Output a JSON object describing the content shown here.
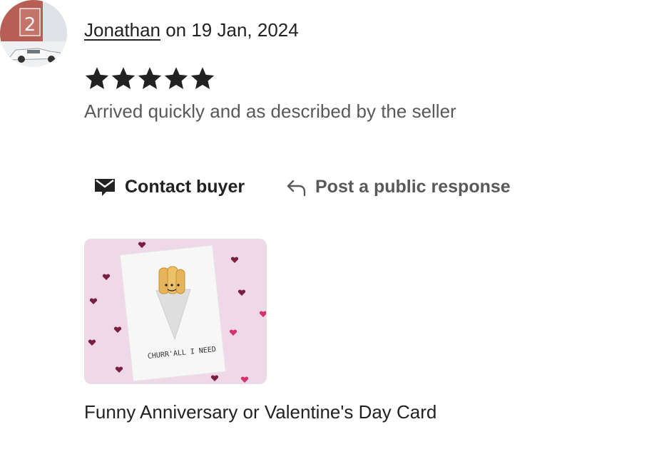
{
  "review": {
    "reviewer_name": "Jonathan",
    "date_text": " on 19 Jan, 2024",
    "rating": 5,
    "max_rating": 5,
    "text": "Arrived quickly and as described by the seller",
    "avatar_badge": "2"
  },
  "actions": {
    "contact_label": "Contact buyer",
    "respond_label": "Post a public response"
  },
  "product": {
    "title": "Funny Anniversary or Valentine's Day Card",
    "card_text": "CHURR'ALL I NEED"
  },
  "colors": {
    "text_primary": "#222222",
    "text_secondary": "#595959",
    "star": "#222222",
    "product_background": "#efd9e8"
  }
}
